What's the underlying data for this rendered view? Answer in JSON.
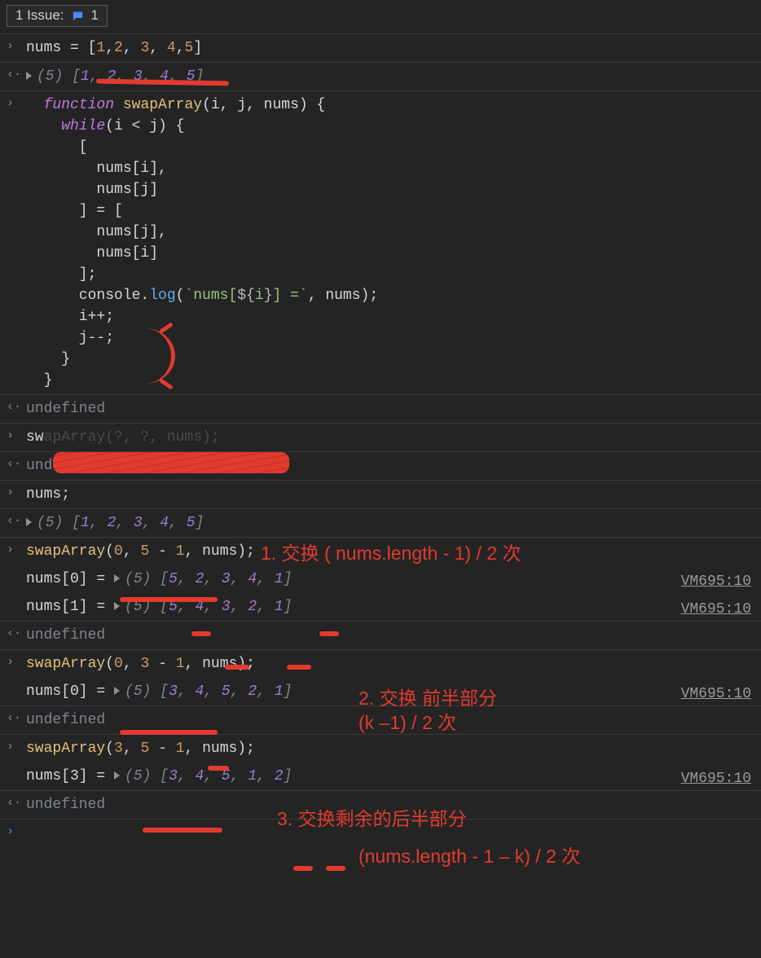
{
  "header": {
    "issue_label": "1 Issue:",
    "issue_count": "1"
  },
  "vm_link": "VM695:10",
  "rows": {
    "input1_prefix": "nums",
    "input1_code_html": "nums = [<span class='num'>1</span>,<span class='num'>2</span>, <span class='num'>3</span>, <span class='num'>4</span>,<span class='num'>5</span>]",
    "array5_eager": "(5)",
    "array_12345_html": "[<span class='numA'>1</span>, <span class='numA'>2</span>, <span class='numA'>3</span>, <span class='numA'>4</span>, <span class='numA'>5</span>]",
    "func_html": "  <span class='kw'>function</span> <span class='name'>swapArray</span>(i, j, nums) {\n    <span class='kw'>while</span>(i &lt; j) {\n      [\n        nums[i],\n        nums[j]\n      ] = [\n        nums[j],\n        nums[i]\n      ];\n      console.<span class='fn'>log</span>(<span class='str'>`nums[<span class='punc'>${</span>i<span class='punc'>}</span>] =`</span>, nums);\n      i++;\n      j--;\n    }\n  }",
    "undef": "undefined",
    "swap_hidden_prefix": "sw",
    "nums_semi": "nums;",
    "swap1_html": "<span class='name'>swapArray</span>(<span class='num'>0</span>, <span class='num'>5</span> - <span class='num'>1</span>, nums);",
    "out0_label": "nums[0] = ",
    "out0_arr_html": "[<span class='numA'>5</span>, <span class='numA'>2</span>, <span class='numA'>3</span>, <span class='numA'>4</span>, <span class='numA'>1</span>]",
    "out1_label": "nums[1] = ",
    "out1_arr_html": "[<span class='numA'>5</span>, <span class='numA'>4</span>, <span class='numA'>3</span>, <span class='numA'>2</span>, <span class='numA'>1</span>]",
    "swap2_html": "<span class='name'>swapArray</span>(<span class='num'>0</span>, <span class='num'>3</span> - <span class='num'>1</span>, nums);",
    "out2_label": "nums[0] = ",
    "out2_arr_html": "[<span class='numA'>3</span>, <span class='numA'>4</span>, <span class='numA'>5</span>, <span class='numA'>2</span>, <span class='numA'>1</span>]",
    "swap3_html": "<span class='name'>swapArray</span>(<span class='num'>3</span>, <span class='num'>5</span> - <span class='num'>1</span>, nums);",
    "out3_label": "nums[3] = ",
    "out3_arr_html": "[<span class='numA'>3</span>, <span class='numA'>4</span>, <span class='numA'>5</span>, <span class='numA'>1</span>, <span class='numA'>2</span>]"
  },
  "annotations": {
    "a1": "1. 交换 ( nums.length - 1) / 2 次",
    "a2_l1": "2. 交换 前半部分",
    "a2_l2": "(k –1)  / 2 次",
    "a3_l1": "3. 交换剩余的后半部分",
    "a3_l2": "(nums.length - 1 – k) / 2 次"
  }
}
